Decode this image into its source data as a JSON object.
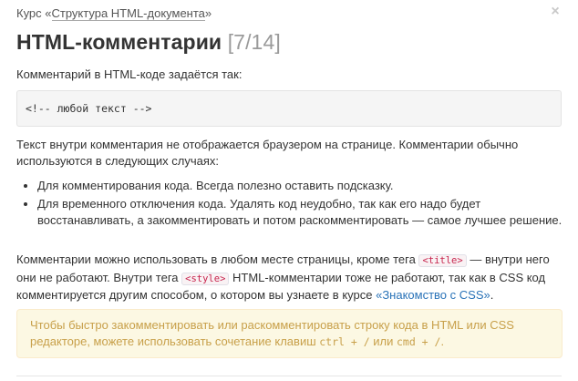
{
  "header": {
    "course_prefix": "Курс «",
    "course_link": "Структура HTML-документа",
    "course_suffix": "»",
    "close_glyph": "×"
  },
  "title": {
    "main": "HTML-комментарии",
    "progress": "[7/14]"
  },
  "content": {
    "intro": "Комментарий в HTML-коде задаётся так:",
    "code_example": "<!-- любой текст -->",
    "paragraph1": "Текст внутри комментария не отображается браузером на странице. Комментарии обычно используются в следующих случаях:",
    "list": [
      "Для комментирования кода. Всегда полезно оставить подсказку.",
      "Для временного отключения кода. Удалять код неудобно, так как его надо будет восстанавливать, а закомментировать и потом раскомментировать — самое лучшее решение."
    ],
    "paragraph2": {
      "part1": "Комментарии можно использовать в любом месте страницы, кроме тега ",
      "code1": "<title>",
      "part2": " — внутри него они не работают. Внутри тега ",
      "code2": "<style>",
      "part3": " HTML-комментарии тоже не работают, так как в CSS код комментируется другим способом, о котором вы узнаете в курсе ",
      "link": "«Знакомство с CSS»",
      "part4": "."
    },
    "tip": {
      "part1": "Чтобы быстро закомментировать или раскомментировать строку кода в HTML или CSS редакторе, можете использовать сочетание клавиш ",
      "key1": "ctrl + /",
      "part2": " или ",
      "key2": "cmd + /",
      "part3": "."
    }
  },
  "colors": {
    "link": "#2a73b8",
    "tip_background": "#fcf8e3",
    "tip_text": "#c8a04a",
    "code_tag": "#c7254e"
  }
}
